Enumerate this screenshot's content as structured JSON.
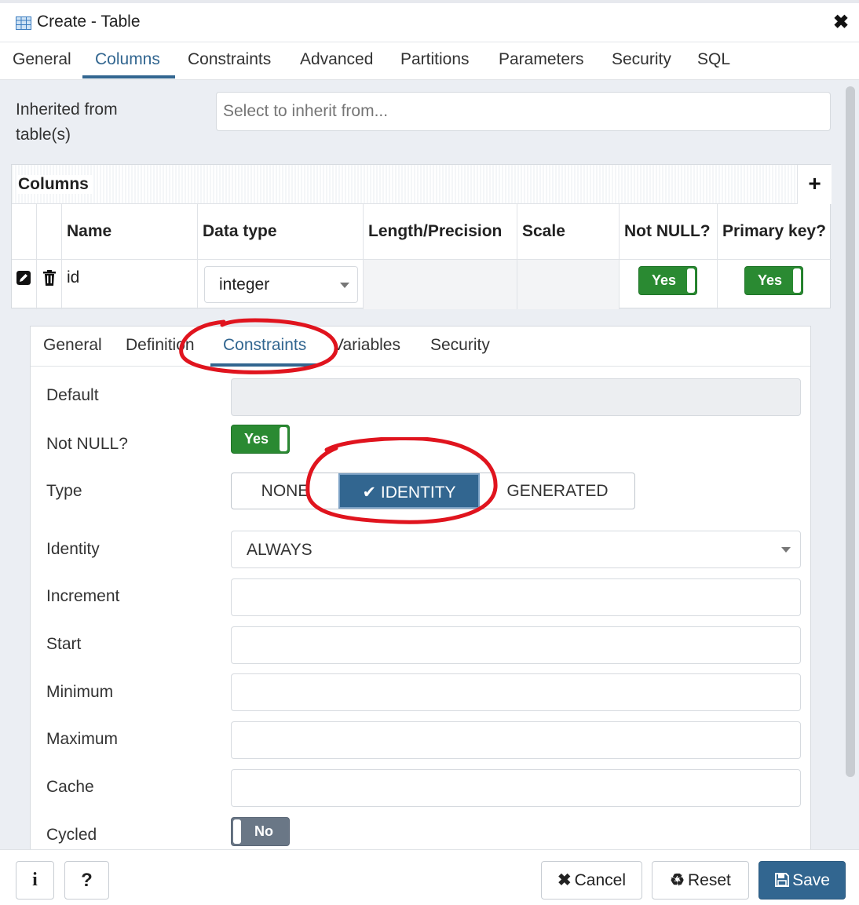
{
  "dialog": {
    "title": "Create - Table"
  },
  "tabs": [
    "General",
    "Columns",
    "Constraints",
    "Advanced",
    "Partitions",
    "Parameters",
    "Security",
    "SQL"
  ],
  "active_tab": "Columns",
  "inherit": {
    "label_line1": "Inherited from",
    "label_line2": "table(s)",
    "placeholder": "Select to inherit from..."
  },
  "columns": {
    "title": "Columns",
    "headers": [
      "Name",
      "Data type",
      "Length/Precision",
      "Scale",
      "Not NULL?",
      "Primary key?"
    ],
    "rows": [
      {
        "name": "id",
        "data_type": "integer",
        "length": "",
        "scale": "",
        "not_null": "Yes",
        "primary_key": "Yes"
      }
    ]
  },
  "column_editor": {
    "tabs": [
      "General",
      "Definition",
      "Constraints",
      "Variables",
      "Security"
    ],
    "active_tab": "Constraints",
    "fields": {
      "default_label": "Default",
      "not_null_label": "Not NULL?",
      "not_null_value": "Yes",
      "type_label": "Type",
      "type_options": [
        "NONE",
        "IDENTITY",
        "GENERATED"
      ],
      "type_selected": "IDENTITY",
      "identity_label": "Identity",
      "identity_value": "ALWAYS",
      "increment_label": "Increment",
      "start_label": "Start",
      "minimum_label": "Minimum",
      "maximum_label": "Maximum",
      "cache_label": "Cache",
      "cycled_label": "Cycled",
      "cycled_value": "No"
    }
  },
  "footer": {
    "info": "i",
    "help": "?",
    "cancel": "Cancel",
    "reset": "Reset",
    "save": "Save"
  },
  "colors": {
    "accent": "#326690",
    "toggle_on": "#2a8a32",
    "toggle_off": "#6a7786",
    "annotation": "#e0141e"
  }
}
